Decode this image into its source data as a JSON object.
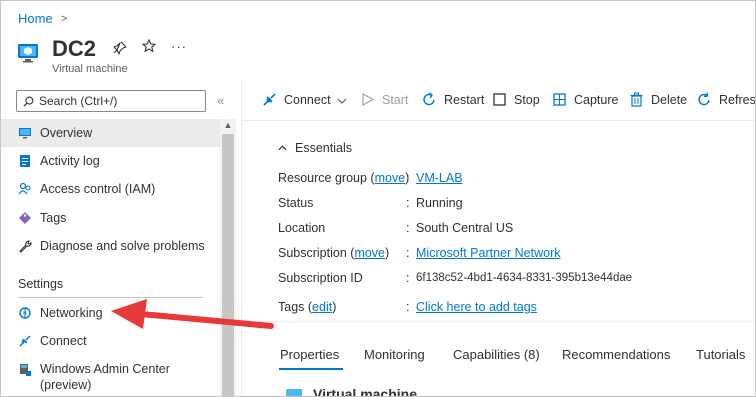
{
  "breadcrumb": {
    "home": "Home",
    "separator": ">"
  },
  "resource": {
    "name": "DC2",
    "type": "Virtual machine"
  },
  "header_actions": {
    "more": "···"
  },
  "search": {
    "placeholder": "Search (Ctrl+/)"
  },
  "nav": {
    "collapse": "«",
    "items": [
      {
        "label": "Overview",
        "icon": "monitor-icon"
      },
      {
        "label": "Activity log",
        "icon": "activity-log-icon"
      },
      {
        "label": "Access control (IAM)",
        "icon": "people-icon"
      },
      {
        "label": "Tags",
        "icon": "tag-icon"
      },
      {
        "label": "Diagnose and solve problems",
        "icon": "wrench-icon"
      }
    ],
    "section_settings": "Settings",
    "settings_items": [
      {
        "label": "Networking",
        "icon": "networking-icon"
      },
      {
        "label": "Connect",
        "icon": "connect-icon"
      },
      {
        "label": "Windows Admin Center",
        "label2": "(preview)",
        "icon": "admin-center-icon"
      }
    ]
  },
  "commands": {
    "connect": "Connect",
    "start": "Start",
    "restart": "Restart",
    "stop": "Stop",
    "capture": "Capture",
    "delete": "Delete",
    "refresh": "Refresh"
  },
  "essentials": {
    "title": "Essentials",
    "rows": {
      "resource_group": {
        "label": "Resource group",
        "link": "move",
        "value": "VM-LAB"
      },
      "status": {
        "label": "Status",
        "value": "Running"
      },
      "location": {
        "label": "Location",
        "value": "South Central US"
      },
      "subscription": {
        "label": "Subscription",
        "link": "move",
        "value": "Microsoft Partner Network"
      },
      "subscription_id": {
        "label": "Subscription ID",
        "value": "6f138c52-4bd1-4634-8331-395b13e44dae"
      },
      "tags": {
        "label": "Tags",
        "link": "edit",
        "value": "Click here to add tags"
      }
    }
  },
  "tabs": [
    "Properties",
    "Monitoring",
    "Capabilities (8)",
    "Recommendations",
    "Tutorials"
  ],
  "section": {
    "title": "Virtual machine"
  },
  "colors": {
    "accent": "#0078d4",
    "annotation_arrow": "#e8393a"
  }
}
